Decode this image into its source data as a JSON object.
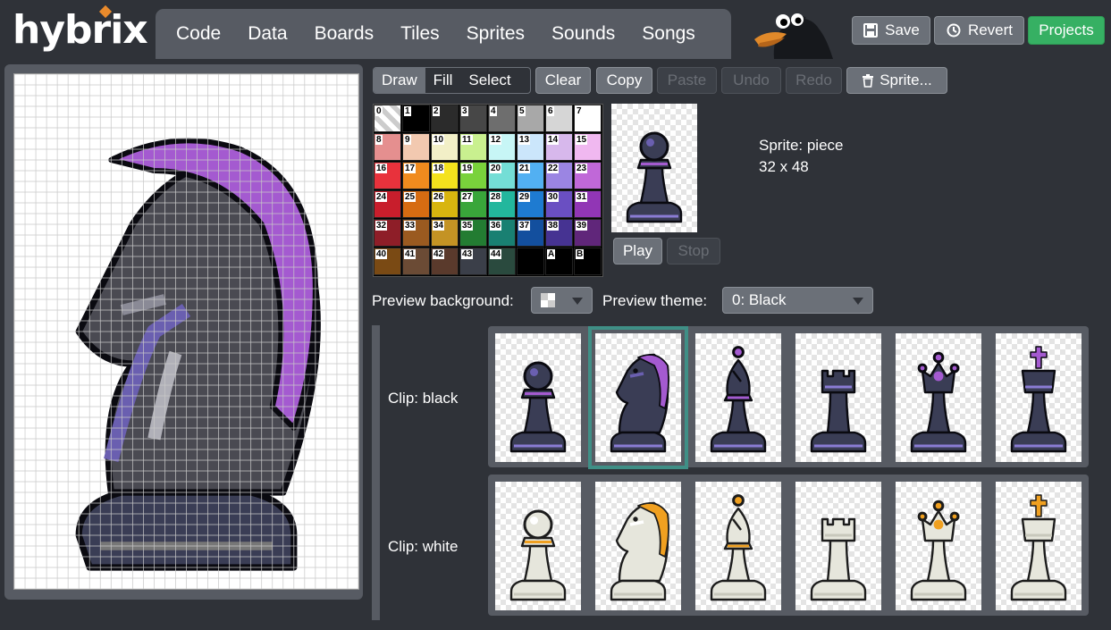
{
  "app": {
    "logo": "hybrix"
  },
  "nav": {
    "tabs": [
      "Code",
      "Data",
      "Boards",
      "Tiles",
      "Sprites",
      "Sounds",
      "Songs"
    ]
  },
  "header_buttons": {
    "save": "Save",
    "revert": "Revert",
    "projects": "Projects"
  },
  "tools": {
    "draw": "Draw",
    "fill": "Fill",
    "select": "Select",
    "active": "Draw",
    "clear": "Clear",
    "copy": "Copy",
    "paste": "Paste",
    "undo": "Undo",
    "redo": "Redo",
    "sprite_menu": "Sprite..."
  },
  "palette": {
    "labels": [
      "0",
      "1",
      "2",
      "3",
      "4",
      "5",
      "6",
      "7",
      "8",
      "9",
      "10",
      "11",
      "12",
      "13",
      "14",
      "15",
      "16",
      "17",
      "18",
      "19",
      "20",
      "21",
      "22",
      "23",
      "24",
      "25",
      "26",
      "27",
      "28",
      "29",
      "30",
      "31",
      "32",
      "33",
      "34",
      "35",
      "36",
      "37",
      "38",
      "39",
      "40",
      "41",
      "42",
      "43",
      "44",
      "",
      "A",
      "B"
    ],
    "colors": [
      "#ffffff",
      "#000000",
      "#2b2b2b",
      "#474747",
      "#6e6e6e",
      "#a8a8a8",
      "#d6d6d6",
      "#ffffff",
      "#e58f8f",
      "#f2c9b0",
      "#f2efc7",
      "#c9f08f",
      "#c7f6f6",
      "#cbe6fb",
      "#d7b8ec",
      "#f0b8f0",
      "#e8323c",
      "#f08b1e",
      "#f4e21d",
      "#79d23b",
      "#74ded6",
      "#52b0f2",
      "#9b85e3",
      "#c068d8",
      "#c81e2c",
      "#d66c12",
      "#d8b50f",
      "#39a63a",
      "#23b79d",
      "#1e7bd1",
      "#6a4fc2",
      "#9136b5",
      "#8e1e28",
      "#9a5a20",
      "#c49324",
      "#237c32",
      "#198072",
      "#134f9e",
      "#463392",
      "#60267a",
      "#7a4a14",
      "#6b4b35",
      "#5a3a2c",
      "#3b3f49",
      "#2a4a3e",
      "#000000",
      "#000000",
      "#000000"
    ]
  },
  "sprite": {
    "name_line": "Sprite: piece",
    "size_line": "32 x 48"
  },
  "playback": {
    "play": "Play",
    "stop": "Stop"
  },
  "preview": {
    "bg_label": "Preview background:",
    "theme_label": "Preview theme:",
    "theme_value": "0: Black"
  },
  "clips": [
    {
      "label": "Clip:  black",
      "theme": "black",
      "pieces": [
        "pawn",
        "knight",
        "bishop",
        "rook",
        "queen",
        "king"
      ],
      "selected": 1
    },
    {
      "label": "Clip:  white",
      "theme": "white",
      "pieces": [
        "pawn",
        "knight",
        "bishop",
        "rook",
        "queen",
        "king"
      ],
      "selected": -1
    }
  ],
  "colors": {
    "accent_green": "#36b063",
    "selection": "#3f8f86",
    "panel": "#575b63",
    "bg": "#2f3238"
  }
}
